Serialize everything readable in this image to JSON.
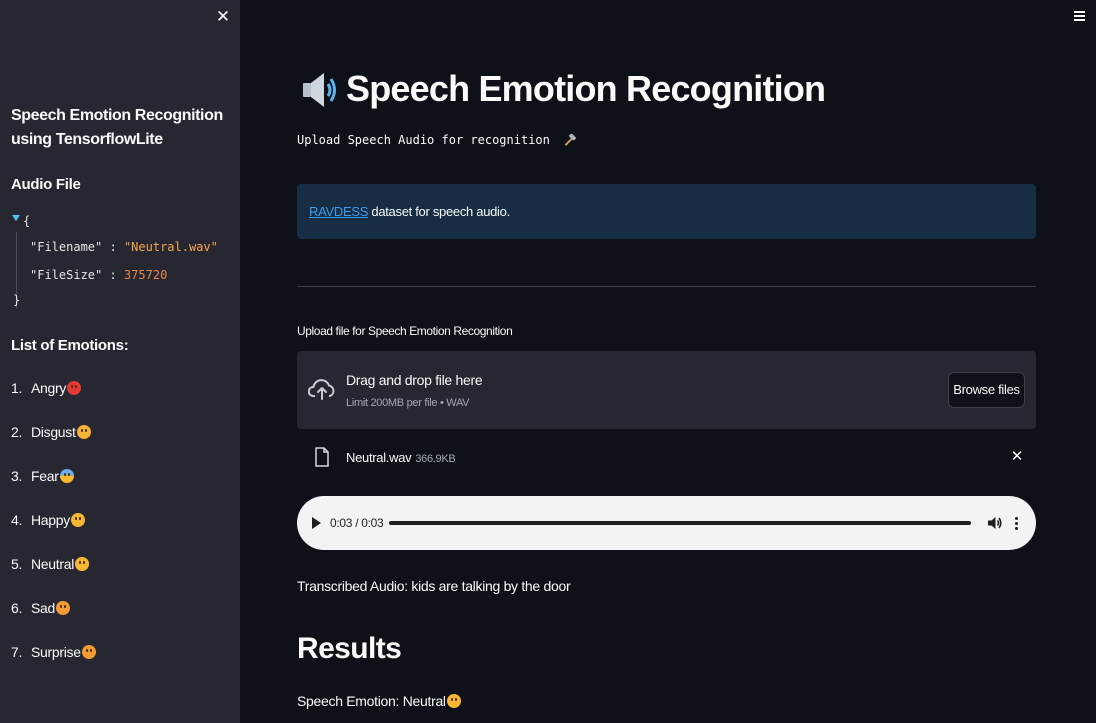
{
  "sidebar": {
    "title": "Speech Emotion Recognition using TensorflowLite",
    "audio_heading": "Audio File",
    "json": {
      "open": "{",
      "close": "}",
      "filename_key": "\"Filename\"",
      "filename_value": "\"Neutral.wav\"",
      "filesize_key": "\"FileSize\"",
      "filesize_value": "375720",
      "separator": ":"
    },
    "emotions_heading": "List of Emotions:",
    "emotions": [
      {
        "num": "1.",
        "label": "Angry",
        "color": "#e53935",
        "icon": "angry-face"
      },
      {
        "num": "2.",
        "label": "Disgust",
        "color": "#f5b335",
        "icon": "tired-face"
      },
      {
        "num": "3.",
        "label": "Fear",
        "color": "#6ab0f3",
        "icon": "screaming-face"
      },
      {
        "num": "4.",
        "label": "Happy",
        "color": "#f7b733",
        "icon": "smiling-face"
      },
      {
        "num": "5.",
        "label": "Neutral",
        "color": "#f7b733",
        "icon": "neutral-face"
      },
      {
        "num": "6.",
        "label": "Sad",
        "color": "#f29c38",
        "icon": "frowning-face"
      },
      {
        "num": "7.",
        "label": "Surprise",
        "color": "#f29c38",
        "icon": "surprised-face"
      }
    ]
  },
  "main": {
    "title": "Speech Emotion Recognition",
    "subtitle": "Upload Speech Audio for recognition",
    "info": {
      "link": "RAVDESS",
      "text": " dataset for speech audio."
    },
    "uploader": {
      "label": "Upload file for Speech Emotion Recognition",
      "drag_text": "Drag and drop file here",
      "limit_text": "Limit 200MB per file • WAV",
      "browse_label": "Browse files"
    },
    "file": {
      "name": "Neutral.wav",
      "size": "366.9KB"
    },
    "player": {
      "time": "0:03 / 0:03",
      "progress": 1.0
    },
    "transcribed": "Transcribed Audio: kids are talking by the door",
    "results_title": "Results",
    "result_line": "Speech Emotion: Neutral",
    "result_icon": "neutral-face"
  },
  "colors": {
    "background": "#0e1117",
    "sidebar": "#262730",
    "info_box": "#172d43",
    "link": "#3d9df3"
  }
}
